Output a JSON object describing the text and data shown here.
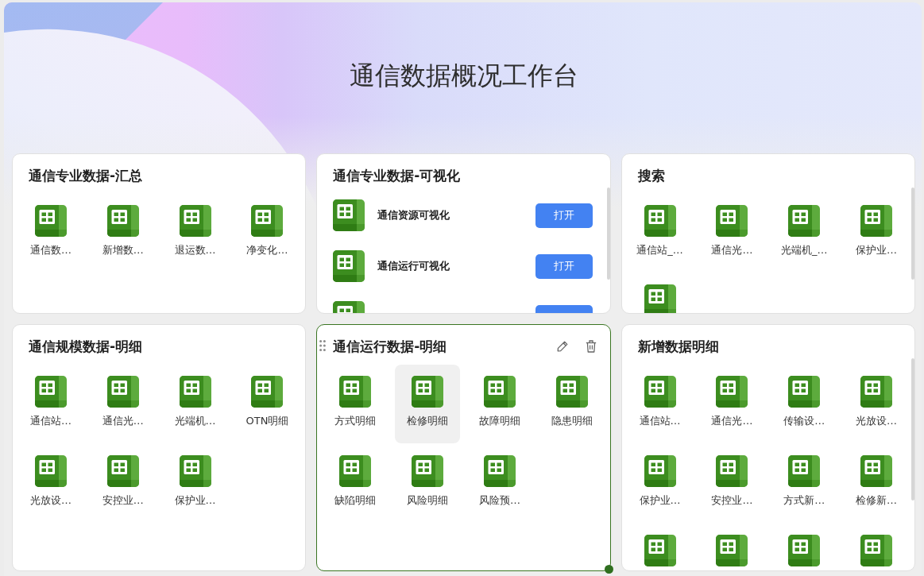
{
  "page": {
    "title": "通信数据概况工作台"
  },
  "cards": [
    {
      "kind": "tiles",
      "title": "通信专业数据-汇总",
      "selected": false,
      "scrollable": false,
      "items": [
        {
          "label": "通信数…"
        },
        {
          "label": "新增数…"
        },
        {
          "label": "退运数…"
        },
        {
          "label": "净变化…"
        }
      ]
    },
    {
      "kind": "list",
      "title": "通信专业数据-可视化",
      "selected": false,
      "scrollable": true,
      "rows": [
        {
          "kind": "row",
          "title": "通信资源可视化",
          "button": "打开"
        },
        {
          "kind": "row",
          "title": "通信运行可视化",
          "button": "打开"
        },
        {
          "kind": "partial"
        }
      ]
    },
    {
      "kind": "tiles",
      "title": "搜索",
      "selected": false,
      "scrollable": true,
      "items": [
        {
          "kind": "tile",
          "label": "通信站_…"
        },
        {
          "kind": "tile",
          "label": "通信光…"
        },
        {
          "kind": "tile",
          "label": "光端机_…"
        },
        {
          "kind": "tile",
          "label": "保护业…"
        },
        {
          "kind": "icon_only"
        }
      ]
    },
    {
      "kind": "tiles",
      "title": "通信规模数据-明细",
      "selected": false,
      "scrollable": false,
      "items": [
        {
          "label": "通信站…"
        },
        {
          "label": "通信光…"
        },
        {
          "label": "光端机…"
        },
        {
          "label": "OTN明细"
        },
        {
          "label": "光放设…"
        },
        {
          "label": "安控业…"
        },
        {
          "label": "保护业…"
        }
      ]
    },
    {
      "kind": "tiles",
      "title": "通信运行数据-明细",
      "selected": true,
      "scrollable": false,
      "items": [
        {
          "label": "方式明细",
          "hovered": false
        },
        {
          "label": "检修明细",
          "hovered": true
        },
        {
          "label": "故障明细",
          "hovered": false
        },
        {
          "label": "隐患明细",
          "hovered": false
        },
        {
          "label": "缺陷明细",
          "hovered": false
        },
        {
          "label": "风险明细",
          "hovered": false
        },
        {
          "label": "风险预…",
          "hovered": false
        }
      ]
    },
    {
      "kind": "tiles",
      "title": "新增数据明细",
      "selected": false,
      "scrollable": true,
      "items": [
        {
          "kind": "tile",
          "label": "通信站…"
        },
        {
          "kind": "tile",
          "label": "通信光…"
        },
        {
          "kind": "tile",
          "label": "传输设…"
        },
        {
          "kind": "tile",
          "label": "光放设…"
        },
        {
          "kind": "tile",
          "label": "保护业…"
        },
        {
          "kind": "tile",
          "label": "安控业…"
        },
        {
          "kind": "tile",
          "label": "方式新…"
        },
        {
          "kind": "tile",
          "label": "检修新…"
        },
        {
          "kind": "icon_only"
        },
        {
          "kind": "icon_only"
        },
        {
          "kind": "icon_only"
        },
        {
          "kind": "icon_only"
        }
      ]
    }
  ]
}
